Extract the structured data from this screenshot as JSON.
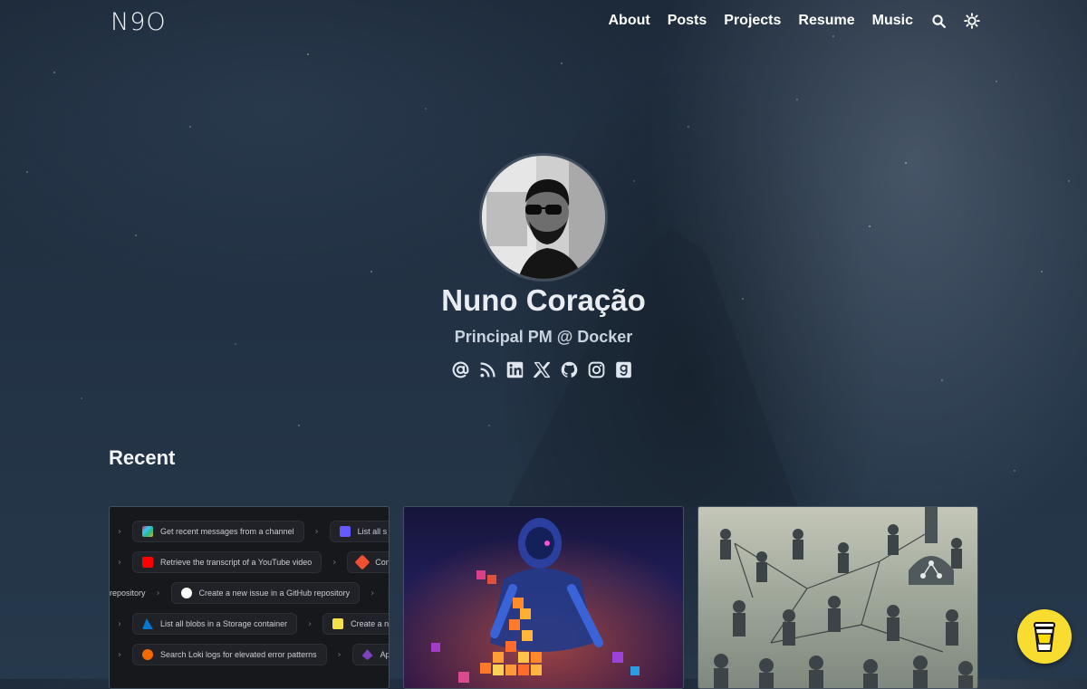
{
  "header": {
    "logo": "N9O",
    "nav": [
      {
        "label": "About"
      },
      {
        "label": "Posts"
      },
      {
        "label": "Projects"
      },
      {
        "label": "Resume"
      },
      {
        "label": "Music"
      }
    ],
    "icons": [
      "search-icon",
      "theme-toggle-icon"
    ]
  },
  "hero": {
    "name": "Nuno Coração",
    "tagline": "Principal PM @ Docker",
    "socials": [
      "email-icon",
      "rss-icon",
      "linkedin-icon",
      "x-icon",
      "github-icon",
      "instagram-icon",
      "goodreads-icon"
    ]
  },
  "recent": {
    "title": "Recent",
    "card1": {
      "rows": [
        {
          "items": [
            "e",
            "Get recent messages from a channel",
            "List all s"
          ]
        },
        {
          "items": [
            "e",
            "Retrieve the transcript of a YouTube video",
            "Comm"
          ]
        },
        {
          "items": [
            "repository",
            "Create a new issue in a GitHub repository"
          ]
        },
        {
          "items": [
            "e",
            "List all blobs in a Storage container",
            "Create a new c"
          ]
        },
        {
          "items": [
            "n",
            "Search Loki logs for elevated error patterns",
            "Ap"
          ]
        }
      ]
    }
  },
  "colors": {
    "accent_coffee": "#f8dc2f",
    "background": "#223244"
  }
}
